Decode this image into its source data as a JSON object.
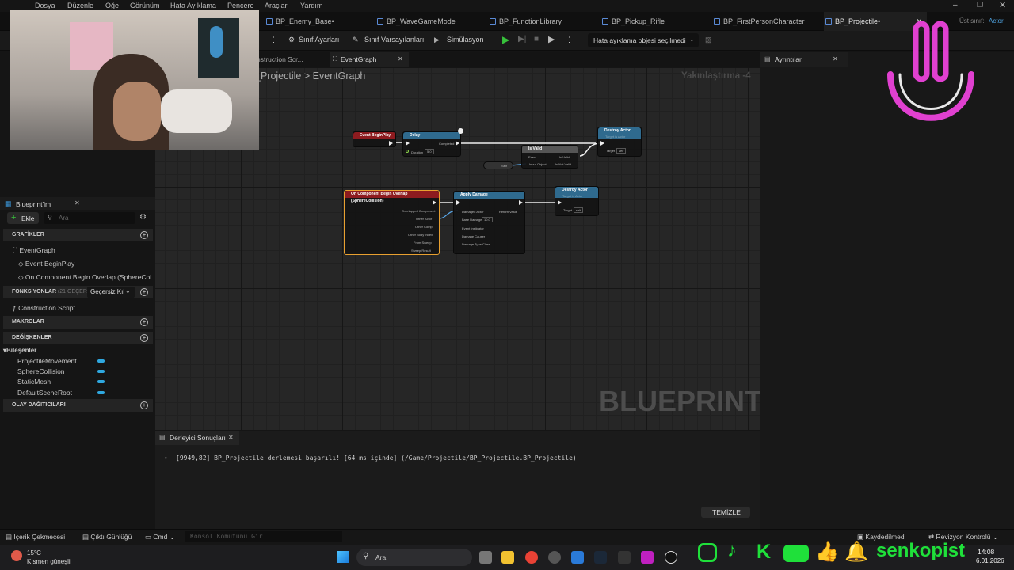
{
  "menu": [
    "Dosya",
    "Düzenle",
    "Öğe",
    "Görünüm",
    "Hata Ayıklama",
    "Pencere",
    "Araçlar",
    "Yardım"
  ],
  "tabs": [
    "BP_Enemy_Base•",
    "BP_WaveGameMode",
    "BP_FunctionLibrary",
    "BP_Pickup_Rifle",
    "BP_FirstPersonCharacter",
    "BP_Projectile•"
  ],
  "parent_class": {
    "label": "Üst sınıf:",
    "value": "Actor"
  },
  "toolbar": {
    "class_settings": "Sınıf Ayarları",
    "class_defaults": "Sınıf Varsayılanları",
    "simulation": "Simülasyon",
    "debug_select": "Hata ayıklama objesi seçilmedi"
  },
  "graph_tabs": {
    "construction": "nstruction Scr...",
    "eventgraph": "EventGraph"
  },
  "breadcrumb": {
    "root": "_Projectile",
    "sep": ">",
    "current": "EventGraph"
  },
  "zoom": "Yakınlaştırma -4",
  "watermark": "BLUEPRINT",
  "details": {
    "title": "Ayrıntılar"
  },
  "my_blueprint": {
    "title": "Blueprint'im",
    "add": "Ekle",
    "search_placeholder": "Ara",
    "graphs_header": "GRAFİKLER",
    "eventgraph": "EventGraph",
    "event_beginplay": "Event BeginPlay",
    "on_overlap": "On Component Begin Overlap (SphereCol",
    "functions_header": "FONKSİYONLAR",
    "functions_count": "(21 GEÇERSİ",
    "override": "Geçersiz Kıl",
    "construction": "Construction Script",
    "macros_header": "MAKROLAR",
    "variables_header": "DEĞİŞKENLER",
    "components_header": "Bileşenler",
    "components": [
      "ProjectileMovement",
      "SphereCollision",
      "StaticMesh",
      "DefaultSceneRoot"
    ],
    "dispatchers_header": "OLAY DAĞITICILARI"
  },
  "nodes": {
    "beginplay": "Event BeginPlay",
    "delay": "Delay",
    "delay_duration_label": "Duration",
    "delay_duration_value": "5.0",
    "delay_completed": "Completed",
    "isvalid": "Is Valid",
    "isvalid_exec": "Exec",
    "isvalid_obj": "Input Object",
    "isvalid_true": "Is Valid",
    "isvalid_false": "Is Not Valid",
    "self": "Self",
    "destroy1": "Destroy Actor",
    "destroy1_sub": "Target is Actor",
    "target": "Target",
    "self_val": "self",
    "overlap": "On Component Begin Overlap (SphereCollision)",
    "overlap_pins": [
      "Overlapped Component",
      "Other Actor",
      "Other Comp",
      "Other Body Index",
      "From Sweep",
      "Sweep Result"
    ],
    "apply": "Apply Damage",
    "apply_pins": [
      "Damaged Actor",
      "Base Damage",
      "Event Instigator",
      "Damage Causer",
      "Damage Type Class"
    ],
    "base_damage": "10.0",
    "return_value": "Return Value",
    "destroy2": "Destroy Actor",
    "destroy2_sub": "Target is Actor"
  },
  "compiler": {
    "title": "Derleyici Sonuçları",
    "message": "[9949,82] BP_Projectile derlemesi başarılı! [64 ms içinde] (/Game/Projectile/BP_Projectile.BP_Projectile)",
    "clear": "TEMİZLE"
  },
  "bottom": {
    "content_drawer": "İçerik Çekmecesi",
    "output_log": "Çıktı Günlüğü",
    "cmd": "Cmd",
    "console_placeholder": "Konsol Komutunu Gir",
    "saved": "Kaydedilmedi",
    "revision": "Revizyon Kontrolü"
  },
  "taskbar": {
    "temp": "15°C",
    "weather": "Kısmen güneşli",
    "search": "Ara",
    "time": "14:08",
    "date": "6.01.2026",
    "channel": "senkopist"
  },
  "colors": {
    "accent_blue": "#2fa8e0",
    "event_red": "#a4161b",
    "function_blue": "#2b5f83",
    "overlay_pink": "#e040d0",
    "overlay_green": "#1fe03a"
  }
}
